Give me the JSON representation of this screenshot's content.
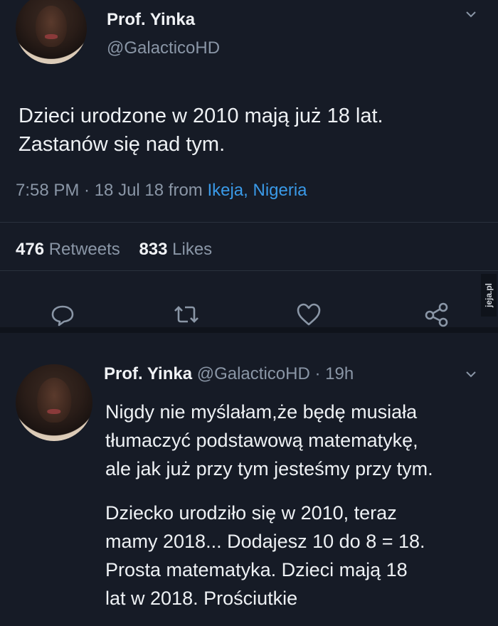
{
  "tweet": {
    "author_name": "Prof. Yinka",
    "author_handle": "@GalacticoHD",
    "text_line1": "Dzieci urodzone w 2010 mają już 18 lat.",
    "text_line2": "Zastanów się nad tym.",
    "time": "7:58 PM · 18 Jul 18 from ",
    "location": "Ikeja, Nigeria",
    "retweets_count": "476",
    "retweets_label": "Retweets",
    "likes_count": "833",
    "likes_label": "Likes",
    "actions": [
      "reply-icon",
      "retweet-icon",
      "like-icon",
      "share-icon"
    ]
  },
  "reply": {
    "author_name": "Prof. Yinka",
    "author_handle": "@GalacticoHD",
    "age": "· 19h",
    "para1_line1": "Nigdy nie myślałam,że będę musiała",
    "para1_line2": "tłumaczyć podstawową matematykę,",
    "para1_line3": "ale jak już przy tym jesteśmy przy tym.",
    "para2_line1": "Dziecko urodziło się w 2010, teraz",
    "para2_line2": "mamy 2018... Dodajesz 10 do 8 = 18.",
    "para2_line3": "Prosta matematyka. Dzieci mają 18",
    "para2_line4": "lat w 2018. Prościutkie"
  },
  "watermark": "jeja.pl",
  "colors": {
    "background": "#161b26",
    "link": "#3a9ae8",
    "muted": "#8a96a6"
  }
}
